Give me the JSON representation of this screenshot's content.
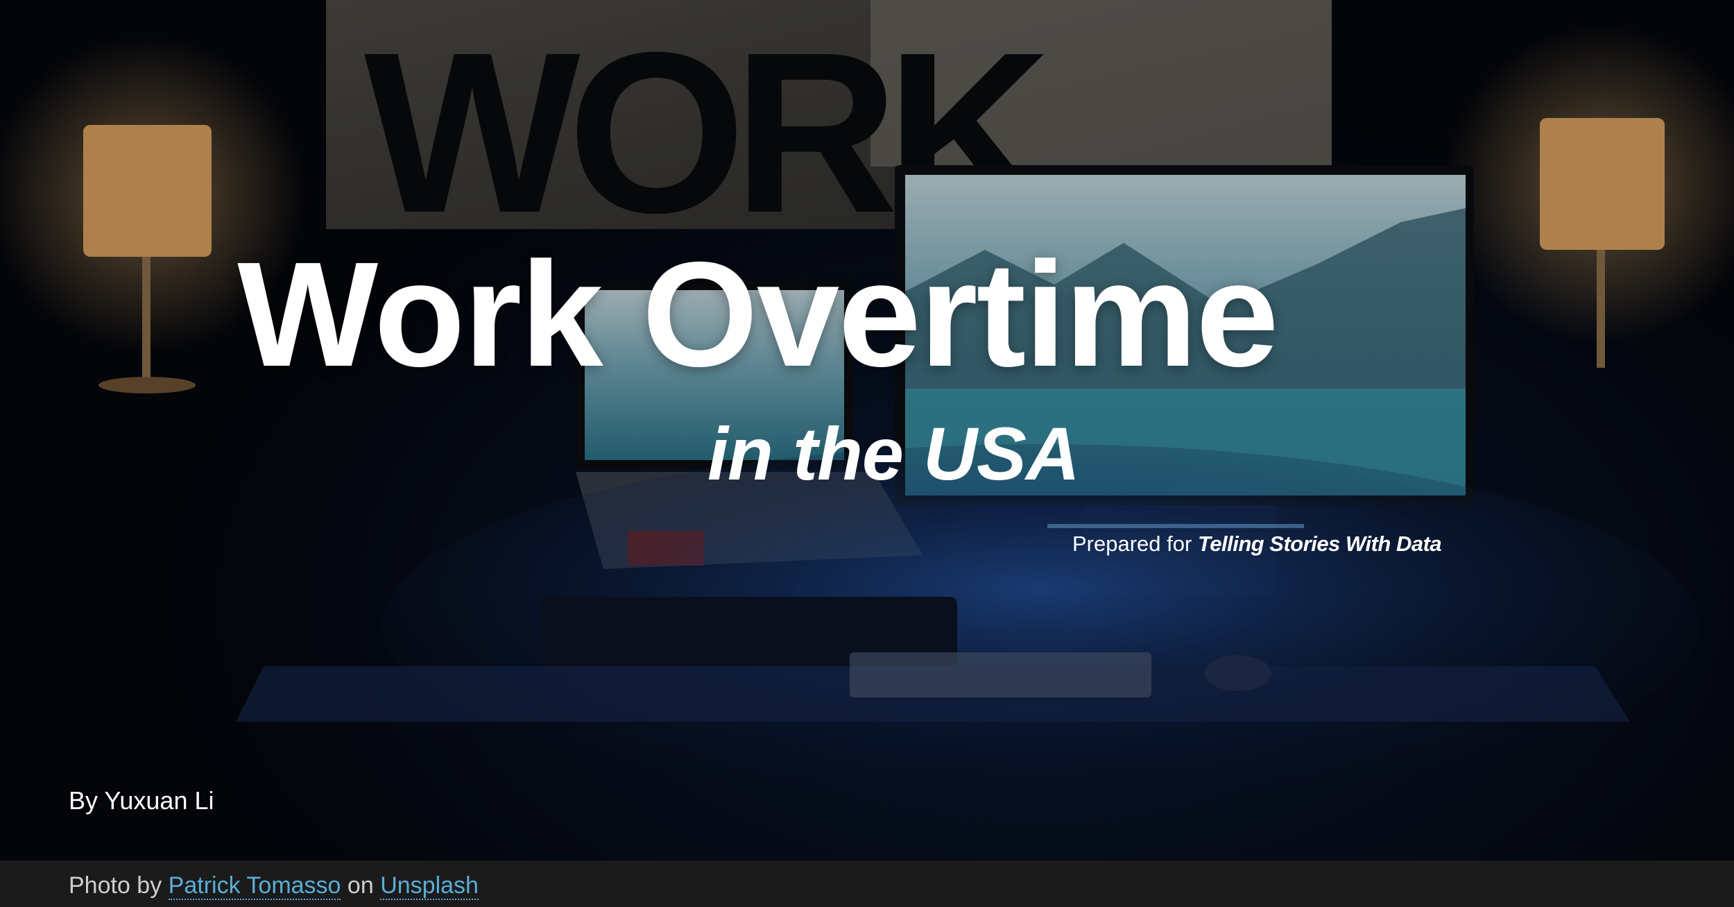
{
  "hero": {
    "title": "Work Overtime",
    "subtitle": "in the USA",
    "prepared_prefix": "Prepared for",
    "prepared_course": "Telling Stories With Data",
    "author": "By Yuxuan Li",
    "background_sign_text": "WORK"
  },
  "footer": {
    "photo_by": "Photo by",
    "photographer": "Patrick Tomasso",
    "on": "on",
    "site": "Unsplash"
  },
  "colors": {
    "title": "#ffffff",
    "link": "#5aaed6",
    "footer_bg": "#1b1b1c",
    "footer_text": "#cfcfcf",
    "lamp_glow": "#f2b36a",
    "screen": "#7fc4d8"
  }
}
